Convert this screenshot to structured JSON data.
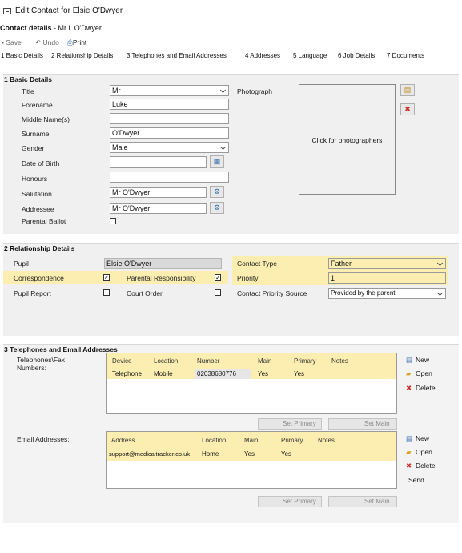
{
  "window": {
    "title": "Edit Contact for Elsie O'Dwyer"
  },
  "contact": {
    "heading": "Contact details",
    "name": "- Mr L O'Dwyer"
  },
  "toolbar": {
    "save": "Save",
    "undo": "Undo",
    "print": "Print"
  },
  "tabs": [
    "1 Basic Details",
    "2 Relationship Details",
    "3 Telephones and Email Addresses",
    "4 Addresses",
    "5 Language",
    "6 Job Details",
    "7 Documents"
  ],
  "basic": {
    "heading_num": "1",
    "heading_text": " Basic Details",
    "labels": {
      "title": "Title",
      "forename": "Forename",
      "middle": "Middle Name(s)",
      "surname": "Surname",
      "gender": "Gender",
      "dob": "Date of Birth",
      "honours": "Honours",
      "salutation": "Salutation",
      "addressee": "Addressee",
      "ballot": "Parental Ballot"
    },
    "values": {
      "title": "Mr",
      "forename": "Luke",
      "middle": "",
      "surname": "O'Dwyer",
      "gender": "Male",
      "dob": "",
      "honours": "",
      "salutation": "Mr O'Dwyer",
      "addressee": "Mr O'Dwyer"
    },
    "photo_label": "Photograph",
    "photo_text": "Click for photographers"
  },
  "relationship": {
    "heading_num": "2",
    "heading_text": " Relationship Details",
    "labels": {
      "pupil": "Pupil",
      "correspondence": "Correspondence",
      "parental": "Parental Responsibility",
      "report": "Pupil Report",
      "court": "Court Order",
      "contact_type": "Contact Type",
      "priority": "Priority",
      "priority_source": "Contact Priority Source"
    },
    "values": {
      "pupil": "Elsie O'Dwyer",
      "contact_type": "Father",
      "priority": "1",
      "priority_source": "Provided by the parent"
    },
    "check": "✓"
  },
  "telephones": {
    "heading_num": "3",
    "heading_text": " Telephones and Email Addresses",
    "phones_label": "Telephones\\Fax Numbers:",
    "phone_columns": [
      "Device",
      "Location",
      "Number",
      "Main",
      "Primary",
      "Notes"
    ],
    "phone_rows": [
      [
        "Telephone",
        "Mobile",
        "02038680776",
        "Yes",
        "Yes",
        ""
      ]
    ],
    "email_label": "Email Addresses:",
    "email_columns": [
      "Address",
      "Location",
      "Main",
      "Primary",
      "Notes"
    ],
    "email_rows": [
      [
        "support@medicaltracker.co.uk",
        "Home",
        "Yes",
        "Yes",
        ""
      ]
    ],
    "set_primary": "Set Primary",
    "set_main": "Set Main",
    "new": "New",
    "open": "Open",
    "delete": "Delete",
    "send": "Send"
  },
  "colors": {
    "highlight": "#fbeeb0",
    "panel": "#f0f0f0",
    "accent": "#3a6fb0"
  }
}
